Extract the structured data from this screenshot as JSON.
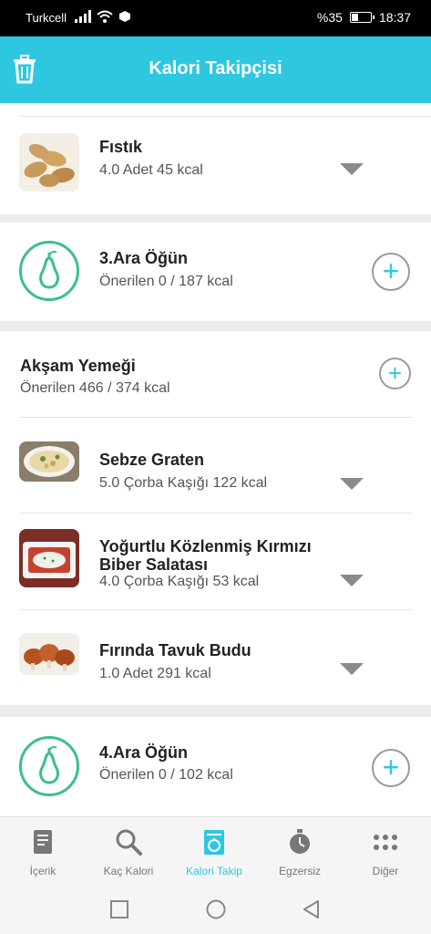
{
  "status_bar": {
    "carrier": "Turkcell",
    "battery_text": "%35",
    "time": "18:37",
    "battery_level": 0.35
  },
  "header": {
    "title": "Kalori Takipçisi",
    "trash_icon": "trash-icon"
  },
  "items": [
    {
      "name": "Fıstık",
      "detail": "4.0 Adet 45 kcal"
    },
    {
      "name": "Sebze Graten",
      "detail": "5.0 Çorba Kaşığı 122 kcal"
    },
    {
      "name": "Yoğurtlu Közlenmiş Kırmızı Biber Salatası",
      "detail": "4.0 Çorba Kaşığı 53 kcal"
    },
    {
      "name": "Fırında Tavuk Budu",
      "detail": "1.0 Adet 291 kcal"
    }
  ],
  "meals": {
    "ara3": {
      "title": "3.Ara Öğün",
      "detail": "Önerilen 0 / 187 kcal"
    },
    "aksam": {
      "title": "Akşam Yemeği",
      "detail": "Önerilen 466 / 374 kcal"
    },
    "ara4": {
      "title": "4.Ara Öğün",
      "detail": "Önerilen 0 / 102 kcal"
    }
  },
  "nav": [
    {
      "label": "İçerik",
      "icon": "book-icon"
    },
    {
      "label": "Kaç Kalori",
      "icon": "search-icon"
    },
    {
      "label": "Kalori Takip",
      "icon": "calorie-tracker-icon"
    },
    {
      "label": "Egzersiz",
      "icon": "stopwatch-icon"
    },
    {
      "label": "Diğer",
      "icon": "more-icon"
    }
  ],
  "colors": {
    "accent": "#2ec7e0",
    "pear_green": "#3cbf8a"
  }
}
